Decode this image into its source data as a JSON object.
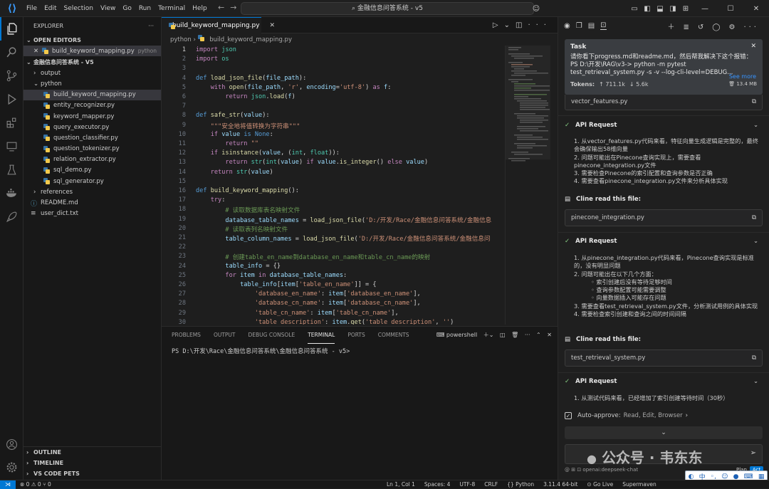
{
  "titlebar": {
    "menu": [
      "File",
      "Edit",
      "Selection",
      "View",
      "Go",
      "Run",
      "Terminal",
      "Help"
    ],
    "search_text": "⌕ 金融信息问答系统 - v5"
  },
  "explorer": {
    "title": "EXPLORER",
    "open_editors_label": "OPEN EDITORS",
    "open_file": "build_keyword_mapping.py",
    "open_file_lang": "python",
    "workspace_label": "金融信息问答系统 - V5",
    "tree": {
      "output": "output",
      "python": "python",
      "files": [
        "build_keyword_mapping.py",
        "entity_recognizer.py",
        "keyword_mapper.py",
        "query_executor.py",
        "question_classifier.py",
        "question_tokenizer.py",
        "relation_extractor.py",
        "sql_demo.py",
        "sql_generator.py"
      ],
      "references": "references",
      "readme": "README.md",
      "userdict": "user_dict.txt"
    },
    "outline_label": "OUTLINE",
    "timeline_label": "TIMELINE",
    "pets_label": "VS CODE PETS"
  },
  "editor": {
    "tab_label": "build_keyword_mapping.py",
    "breadcrumb_folder": "python",
    "breadcrumb_file": "build_keyword_mapping.py",
    "lines": [
      {
        "n": "1",
        "html": "<span class='k'>import</span> <span class='t'>json</span>"
      },
      {
        "n": "2",
        "html": "<span class='k'>import</span> <span class='t'>os</span>"
      },
      {
        "n": "3",
        "html": ""
      },
      {
        "n": "4",
        "html": "<span class='d'>def</span> <span class='f'>load_json_file</span>(<span class='v'>file_path</span>):"
      },
      {
        "n": "5",
        "html": "    <span class='k'>with</span> <span class='f'>open</span>(<span class='v'>file_path</span>, <span class='s'>'r'</span>, <span class='v'>encoding</span>=<span class='s'>'utf-8'</span>) <span class='k'>as</span> <span class='v'>f</span>:"
      },
      {
        "n": "6",
        "html": "        <span class='k'>return</span> <span class='t'>json</span>.<span class='f'>load</span>(<span class='v'>f</span>)"
      },
      {
        "n": "7",
        "html": ""
      },
      {
        "n": "8",
        "html": "<span class='d'>def</span> <span class='f'>safe_str</span>(<span class='v'>value</span>):"
      },
      {
        "n": "9",
        "html": "    <span class='s'>\"\"\"安全地将值转换为字符串\"\"\"</span>"
      },
      {
        "n": "10",
        "html": "    <span class='k'>if</span> <span class='v'>value</span> <span class='d'>is</span> <span class='d'>None</span>:"
      },
      {
        "n": "11",
        "html": "        <span class='k'>return</span> <span class='s'>\"\"</span>"
      },
      {
        "n": "12",
        "html": "    <span class='k'>if</span> <span class='f'>isinstance</span>(<span class='v'>value</span>, (<span class='t'>int</span>, <span class='t'>float</span>)):"
      },
      {
        "n": "13",
        "html": "        <span class='k'>return</span> <span class='t'>str</span>(<span class='t'>int</span>(<span class='v'>value</span>) <span class='k'>if</span> <span class='v'>value</span>.<span class='f'>is_integer</span>() <span class='k'>else</span> <span class='v'>value</span>)"
      },
      {
        "n": "14",
        "html": "    <span class='k'>return</span> <span class='t'>str</span>(<span class='v'>value</span>)"
      },
      {
        "n": "15",
        "html": ""
      },
      {
        "n": "16",
        "html": "<span class='d'>def</span> <span class='f'>build_keyword_mapping</span>():"
      },
      {
        "n": "17",
        "html": "    <span class='k'>try</span>:"
      },
      {
        "n": "18",
        "html": "        <span class='c'># 读取数据库表名映射文件</span>"
      },
      {
        "n": "19",
        "html": "        <span class='v'>database_table_names</span> = <span class='f'>load_json_file</span>(<span class='s'>'D:/开发/Race/金融信息问答系统/金融信息</span>"
      },
      {
        "n": "20",
        "html": "        <span class='c'># 读取表列名映射文件</span>"
      },
      {
        "n": "21",
        "html": "        <span class='v'>table_column_names</span> = <span class='f'>load_json_file</span>(<span class='s'>'D:/开发/Race/金融信息问答系统/金融信息问</span>"
      },
      {
        "n": "22",
        "html": ""
      },
      {
        "n": "23",
        "html": "        <span class='c'># 创建table_en_name到database_en_name和table_cn_name的映射</span>"
      },
      {
        "n": "24",
        "html": "        <span class='v'>table_info</span> = {}"
      },
      {
        "n": "25",
        "html": "        <span class='k'>for</span> <span class='v'>item</span> <span class='k'>in</span> <span class='v'>database_table_names</span>:"
      },
      {
        "n": "26",
        "html": "            <span class='v'>table_info</span>[<span class='v'>item</span>[<span class='s'>'table_en_name'</span>]] = {"
      },
      {
        "n": "27",
        "html": "                <span class='s'>'database_en_name'</span>: <span class='v'>item</span>[<span class='s'>'database_en_name'</span>],"
      },
      {
        "n": "28",
        "html": "                <span class='s'>'database_cn_name'</span>: <span class='v'>item</span>[<span class='s'>'database_cn_name'</span>],"
      },
      {
        "n": "29",
        "html": "                <span class='s'>'table_cn_name'</span>: <span class='v'>item</span>[<span class='s'>'table_cn_name'</span>],"
      },
      {
        "n": "30",
        "html": "                <span class='s'>'table_description'</span>: <span class='v'>item</span>.<span class='f'>get</span>(<span class='s'>'table_description'</span>, <span class='s'>''</span>)"
      }
    ]
  },
  "panel": {
    "tabs": [
      "PROBLEMS",
      "OUTPUT",
      "DEBUG CONSOLE",
      "TERMINAL",
      "PORTS",
      "COMMENTS"
    ],
    "shell": "powershell",
    "prompt": "PS D:\\开发\\Race\\金融信息问答系统\\金融信息问答系统 - v5>"
  },
  "cline": {
    "task_label": "Task",
    "task_text": "请你看下progress.md和readme.md，然后帮我解决下这个报错：PS D:\\开发\\RAG\\v3-> python -m pytest test_retrieval_system.py -s -v --log-cli-level=DEBUG...",
    "see_more": "See more",
    "tokens_label": "Tokens:",
    "tokens_up": "↑ 711.1k",
    "tokens_down": "↓ 5.6k",
    "size": "13.4 MB",
    "file1": "vector_features.py",
    "api_label": "API Request",
    "req1": [
      "1. 从vector_features.py代码来看，特征向量生成逻辑是完整的，最终会确保输出58维向量",
      "2. 问题可能出在Pinecone查询实现上，需要查看pinecone_integration.py文件",
      "3. 需要检查Pinecone的索引配置和查询参数是否正确",
      "4. 需要查看pinecone_integration.py文件来分析具体实现"
    ],
    "read_label": "Cline read this file:",
    "file2": "pinecone_integration.py",
    "req2": [
      "1. 从pinecone_integration.py代码来看，Pinecone查询实现是标准的，没有明显问题",
      "2. 问题可能出在以下几个方面："
    ],
    "req2_sub": [
      "◦ 索引创建后没有等待足够时间",
      "◦ 查询参数配置可能需要调整",
      "◦ 向量数据插入可能存在问题"
    ],
    "req2_tail": [
      "3. 需要查看test_retrieval_system.py文件，分析测试用例的具体实现",
      "4. 需要检查索引创建和查询之间的时间间隔"
    ],
    "file3": "test_retrieval_system.py",
    "req3": [
      "1. 从测试代码来看，已经增加了索引创建等待时间（30秒）"
    ],
    "auto_approve_label": "Auto-approve:",
    "auto_approve_items": "Read, Edit, Browser",
    "watermark": "公众号 · 韦东东",
    "model": "openai:deepseek-chat",
    "plan": "Plan",
    "act": "Act"
  },
  "status": {
    "left": "⊗ 0 ⚠ 0   ⑂ 0",
    "items": [
      "Ln 1, Col 1",
      "Spaces: 4",
      "UTF-8",
      "CRLF",
      "{} Python",
      "3.11.4 64-bit",
      "⊙ Go Live",
      "Supermaven"
    ]
  }
}
